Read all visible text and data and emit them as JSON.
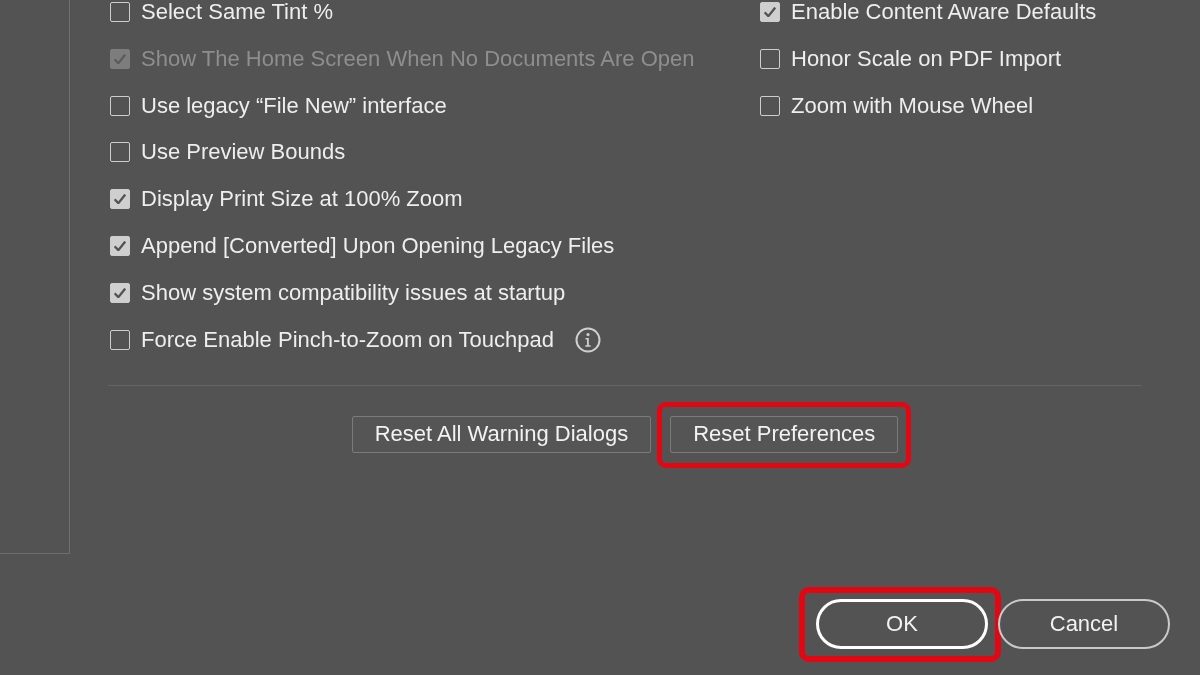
{
  "options_left": [
    {
      "label": "Select Same Tint %",
      "checked": false,
      "disabled": false,
      "info_icon": false
    },
    {
      "label": "Show The Home Screen When No Documents Are Open",
      "checked": true,
      "disabled": true,
      "info_icon": false
    },
    {
      "label": "Use legacy “File New” interface",
      "checked": false,
      "disabled": false,
      "info_icon": false
    },
    {
      "label": "Use Preview Bounds",
      "checked": false,
      "disabled": false,
      "info_icon": false
    },
    {
      "label": "Display Print Size at 100% Zoom",
      "checked": true,
      "disabled": false,
      "info_icon": false
    },
    {
      "label": "Append [Converted] Upon Opening Legacy Files",
      "checked": true,
      "disabled": false,
      "info_icon": false
    },
    {
      "label": "Show system compatibility issues at startup",
      "checked": true,
      "disabled": false,
      "info_icon": false
    },
    {
      "label": "Force Enable Pinch-to-Zoom on Touchpad",
      "checked": false,
      "disabled": false,
      "info_icon": true
    }
  ],
  "options_right": [
    {
      "label": "Enable Content Aware Defaults",
      "checked": true,
      "disabled": false,
      "info_icon": false
    },
    {
      "label": "Honor Scale on PDF Import",
      "checked": false,
      "disabled": false,
      "info_icon": false
    },
    {
      "label": "Zoom with Mouse Wheel",
      "checked": false,
      "disabled": false,
      "info_icon": false
    }
  ],
  "reset_buttons": [
    {
      "label": "Reset All Warning Dialogs",
      "highlighted": false
    },
    {
      "label": "Reset Preferences",
      "highlighted": true
    }
  ],
  "dialog_buttons": [
    {
      "label": "OK",
      "default": true,
      "highlighted": true
    },
    {
      "label": "Cancel",
      "default": false,
      "highlighted": false
    }
  ]
}
